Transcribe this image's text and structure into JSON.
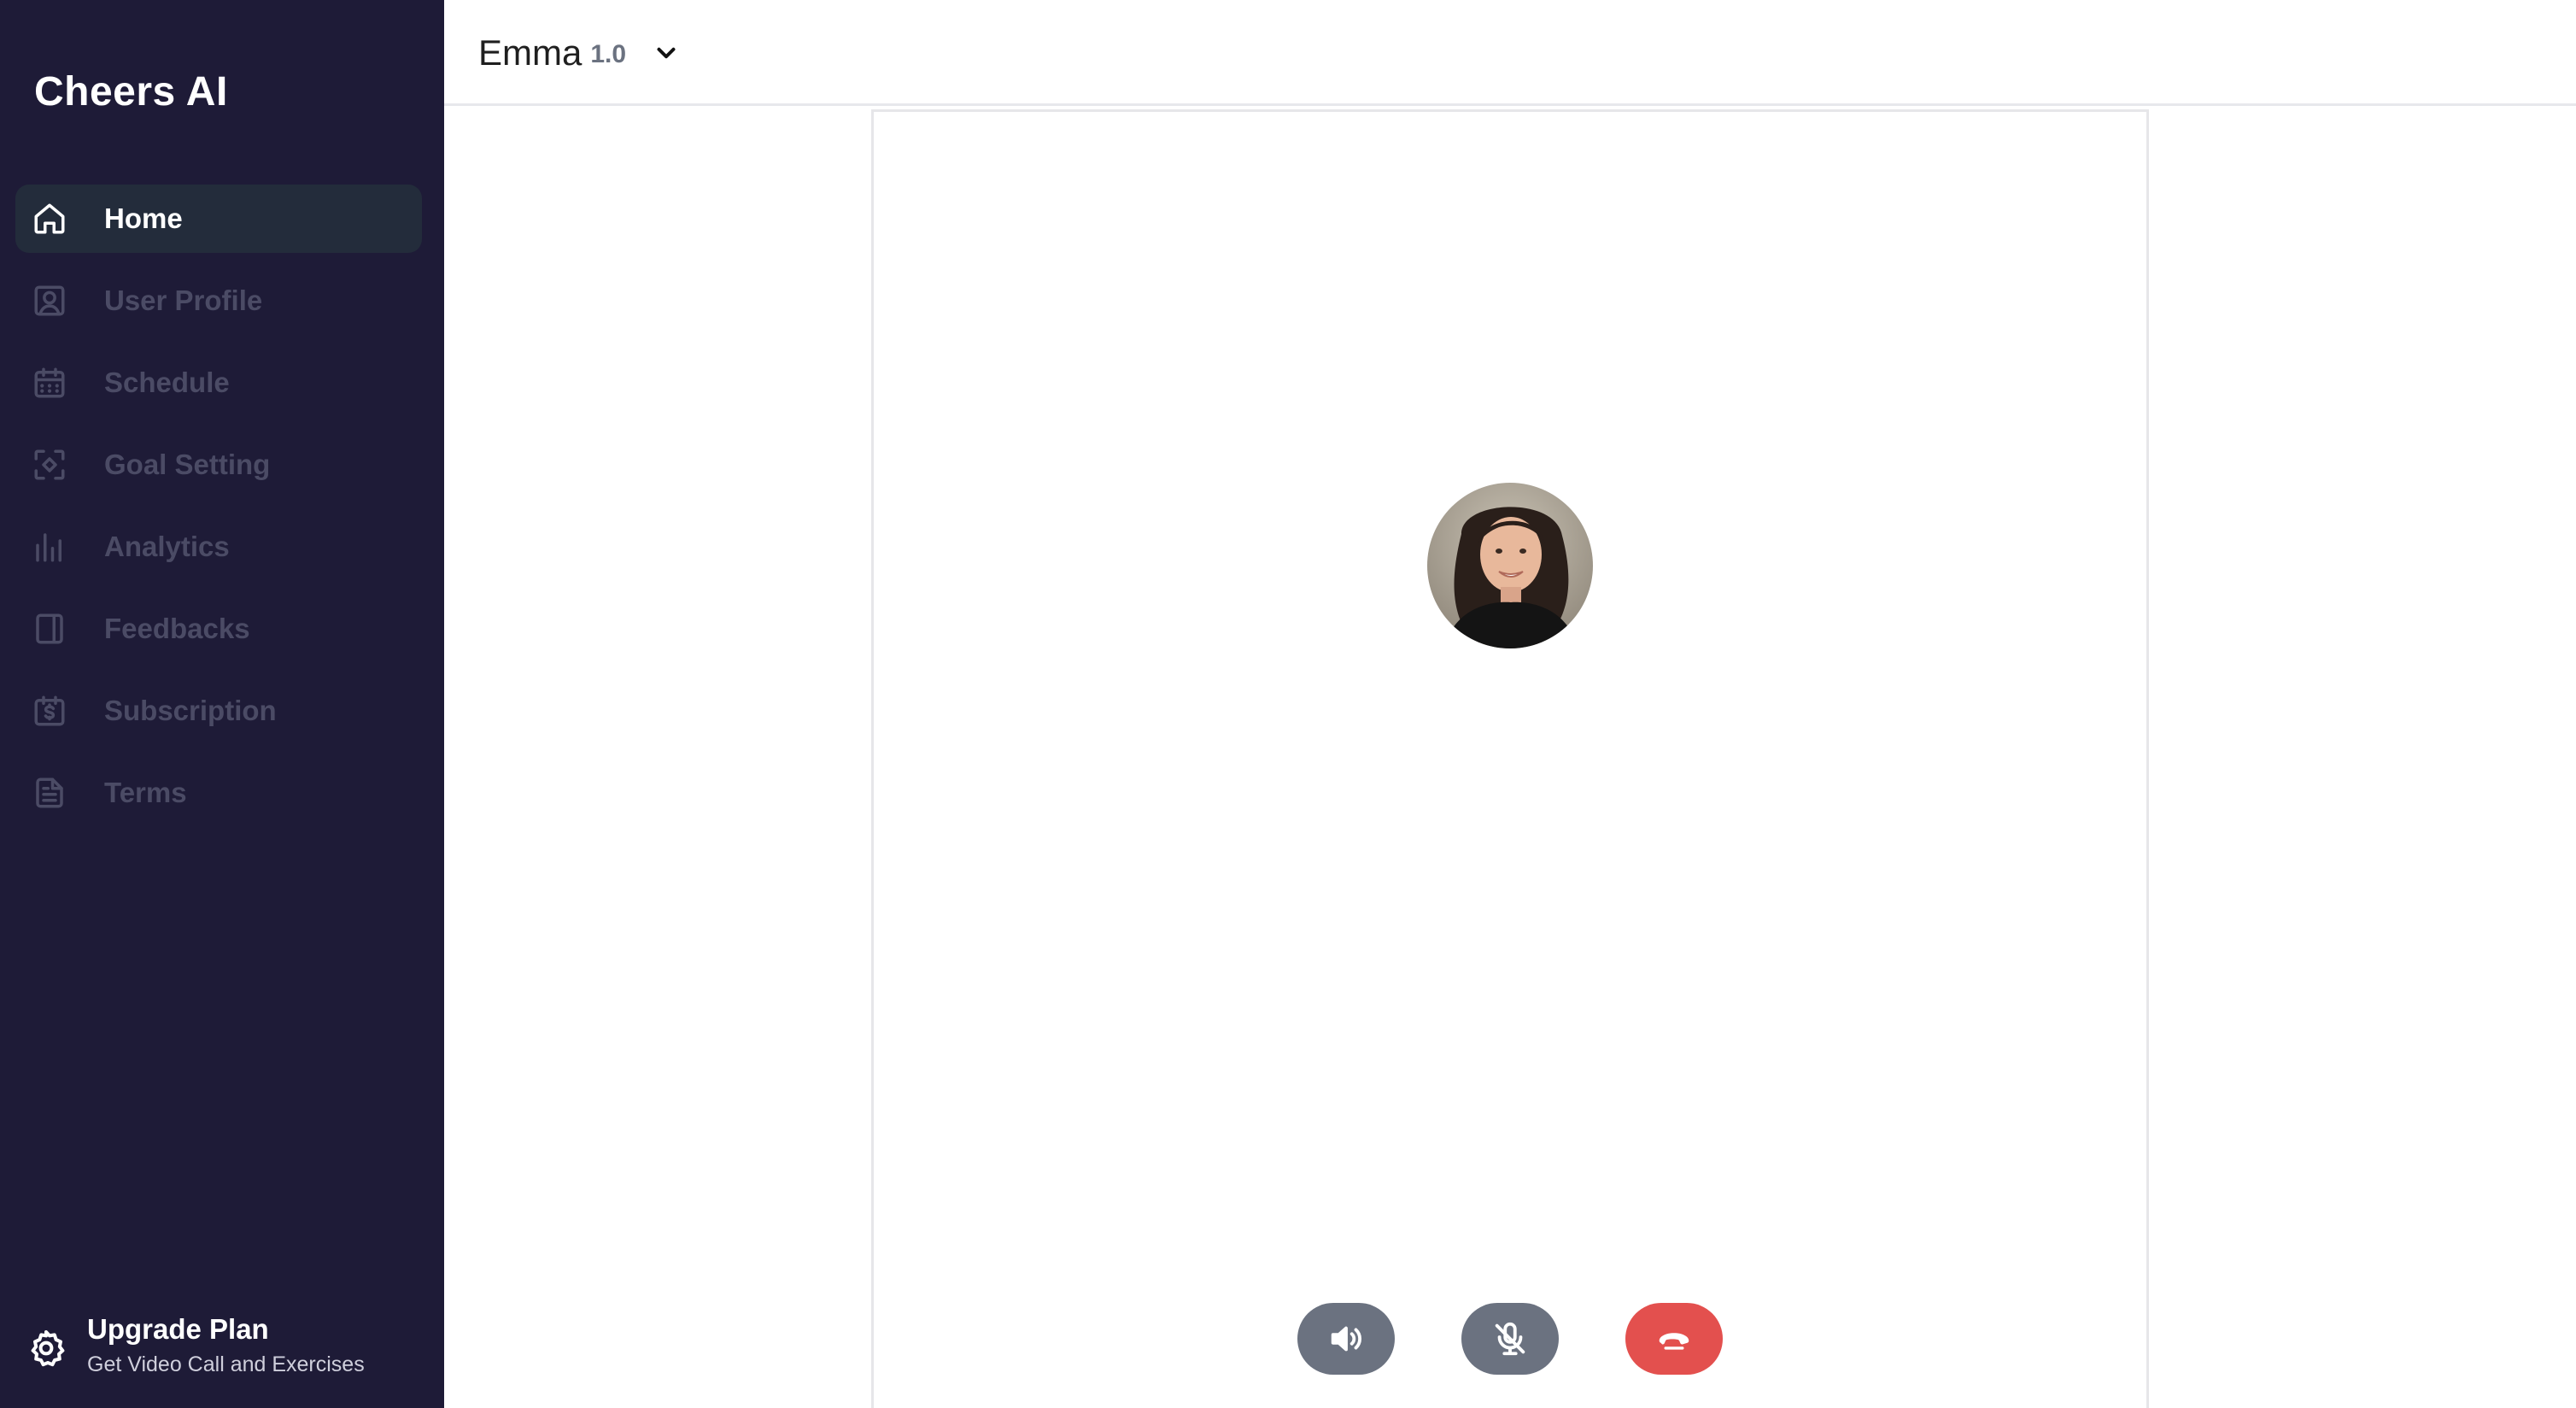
{
  "app": {
    "brand": "Cheers AI"
  },
  "sidebar": {
    "items": [
      {
        "label": "Home",
        "icon": "home-icon",
        "active": true
      },
      {
        "label": "User Profile",
        "icon": "user-profile-icon",
        "active": false
      },
      {
        "label": "Schedule",
        "icon": "calendar-icon",
        "active": false
      },
      {
        "label": "Goal Setting",
        "icon": "target-icon",
        "active": false
      },
      {
        "label": "Analytics",
        "icon": "bar-chart-icon",
        "active": false
      },
      {
        "label": "Feedbacks",
        "icon": "book-icon",
        "active": false
      },
      {
        "label": "Subscription",
        "icon": "dollar-calendar-icon",
        "active": false
      },
      {
        "label": "Terms",
        "icon": "document-icon",
        "active": false
      }
    ],
    "upgrade": {
      "title": "Upgrade Plan",
      "subtitle": "Get Video Call and Exercises",
      "icon": "gear-icon"
    }
  },
  "header": {
    "agent_name": "Emma",
    "agent_version": "1.0",
    "dropdown_icon": "chevron-down-icon"
  },
  "call": {
    "avatar": "avatar-photo",
    "controls": [
      {
        "name": "speaker",
        "icon": "speaker-icon"
      },
      {
        "name": "mute",
        "icon": "mic-off-icon"
      },
      {
        "name": "hang-up",
        "icon": "phone-hangup-icon"
      }
    ]
  },
  "colors": {
    "sidebar_bg": "#1e1b37",
    "active_item_bg": "#232c3b",
    "inactive_text": "#4b4b65",
    "control_gray": "#6b7280",
    "hangup_red": "#e3504e"
  }
}
